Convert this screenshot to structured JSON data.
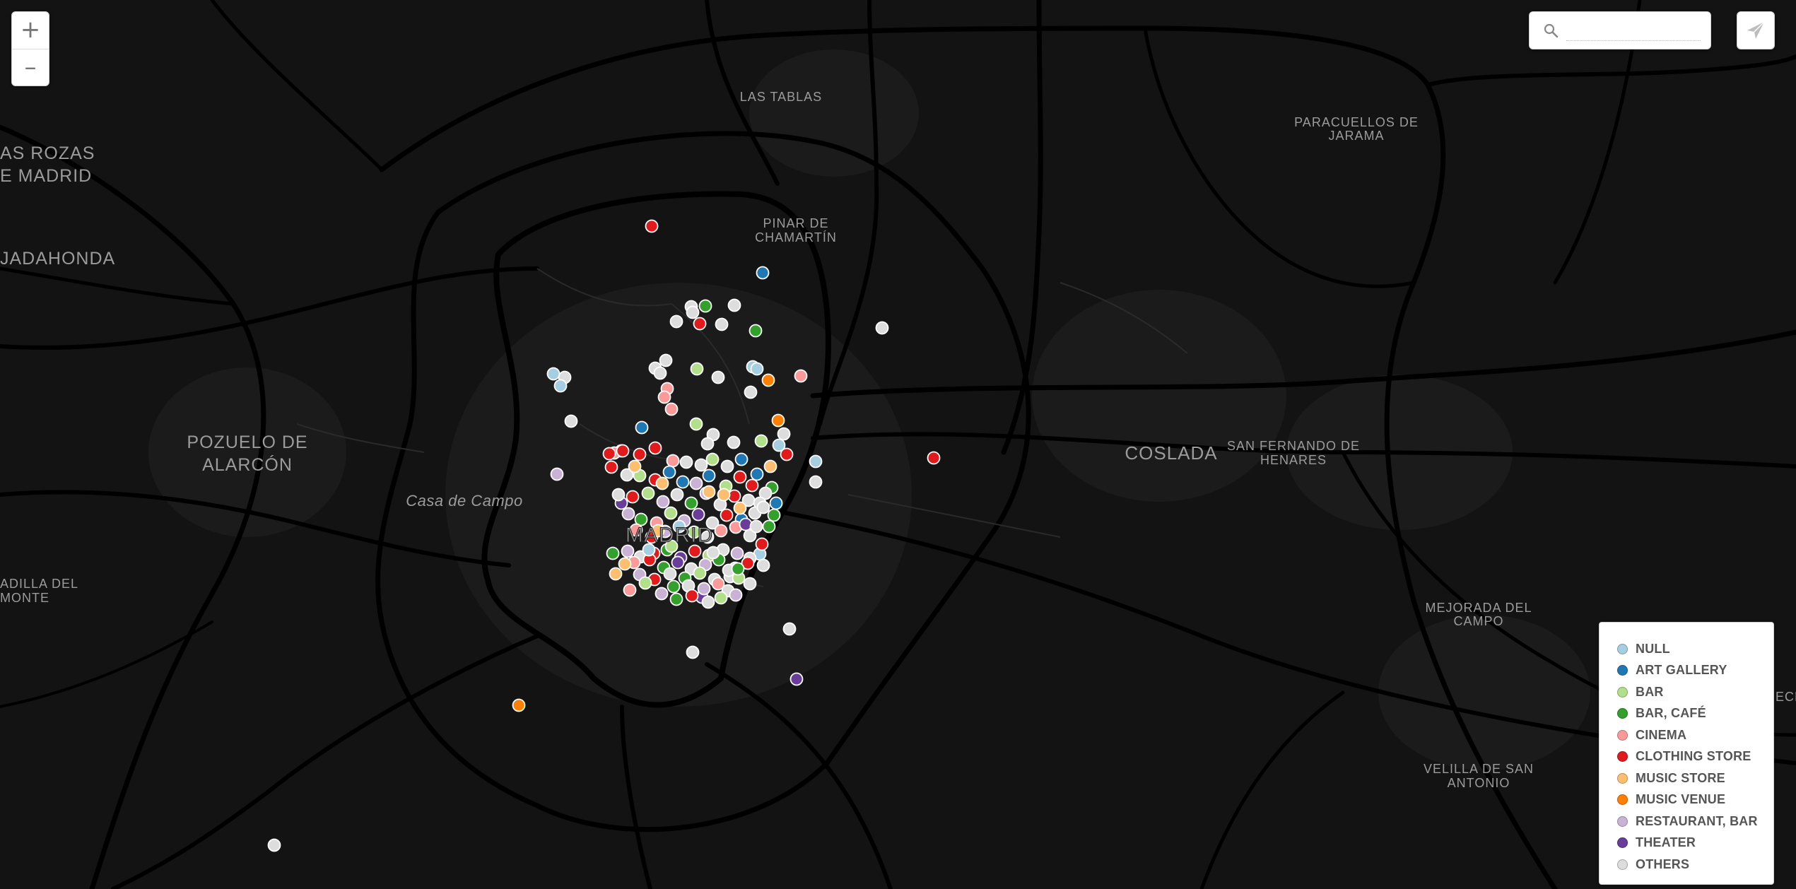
{
  "map": {
    "place_labels": {
      "las_tablas": "LAS TABLAS",
      "paracuellos": [
        "PARACUELLOS DE",
        "JARAMA"
      ],
      "las_rozas": [
        "AS ROZAS",
        "E MADRID"
      ],
      "pinar": [
        "PINAR DE",
        "CHAMARTÍN"
      ],
      "majadahonda": "JADAHONDA",
      "pozuelo": [
        "POZUELO DE",
        "ALARCÓN"
      ],
      "coslada": "COSLADA",
      "san_fernando": [
        "SAN FERNANDO DE",
        "HENARES"
      ],
      "casa_de_campo": "Casa de Campo",
      "madrid": "MADRID",
      "boadilla": [
        "ADILLA DEL",
        "MONTE"
      ],
      "mejorada": [
        "MEJORADA DEL",
        "CAMPO"
      ],
      "velilla": [
        "VELILLA DE SAN",
        "ANTONIO"
      ],
      "edge_right": "ECH"
    }
  },
  "zoom": {
    "in_label": "+",
    "out_label": "–"
  },
  "search": {
    "icon": "search-icon",
    "value": "",
    "placeholder": ""
  },
  "locate": {
    "icon": "paper-plane-icon"
  },
  "legend": {
    "items": [
      {
        "label": "NULL",
        "color": "#a6cee3"
      },
      {
        "label": "ART GALLERY",
        "color": "#1f78b4"
      },
      {
        "label": "BAR",
        "color": "#b2df8a"
      },
      {
        "label": "BAR, CAFÉ",
        "color": "#33a02c"
      },
      {
        "label": "CINEMA",
        "color": "#fb9a99"
      },
      {
        "label": "CLOTHING STORE",
        "color": "#e31a1c"
      },
      {
        "label": "MUSIC STORE",
        "color": "#fdbf6f"
      },
      {
        "label": "MUSIC VENUE",
        "color": "#ff7f00"
      },
      {
        "label": "RESTAURANT, BAR",
        "color": "#cab2d6"
      },
      {
        "label": "THEATER",
        "color": "#6a3d9a"
      },
      {
        "label": "OTHERS",
        "color": "#dddddd"
      }
    ]
  }
}
